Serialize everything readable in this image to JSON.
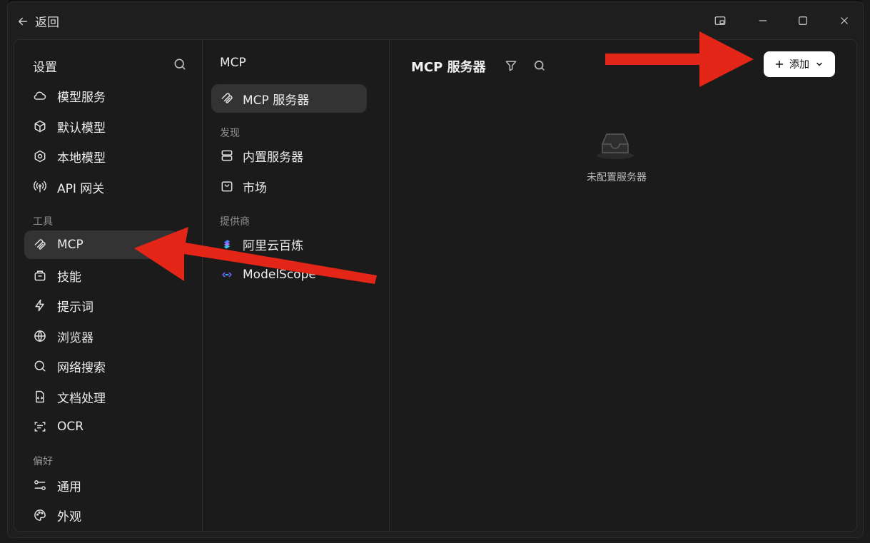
{
  "titlebar": {
    "back_label": "返回"
  },
  "sidebar": {
    "title": "设置",
    "groups": {
      "main": [
        "模型服务",
        "默认模型",
        "本地模型",
        "API 网关"
      ],
      "tools_label": "工具",
      "tools": [
        "MCP",
        "技能",
        "提示词",
        "浏览器",
        "网络搜索",
        "文档处理",
        "OCR"
      ],
      "prefs_label": "偏好",
      "prefs": [
        "通用",
        "外观"
      ]
    }
  },
  "mcp_nav": {
    "title": "MCP",
    "servers": "MCP 服务器",
    "discover_label": "发现",
    "discover": [
      "内置服务器",
      "市场"
    ],
    "providers_label": "提供商",
    "providers": [
      "阿里云百炼",
      "ModelScope"
    ]
  },
  "content": {
    "title": "MCP 服务器",
    "add_label": "添加",
    "empty_text": "未配置服务器"
  },
  "colors": {
    "accent_arrow": "#e32617",
    "active_bg": "#333333",
    "panel_bg": "#1b1b1b"
  }
}
